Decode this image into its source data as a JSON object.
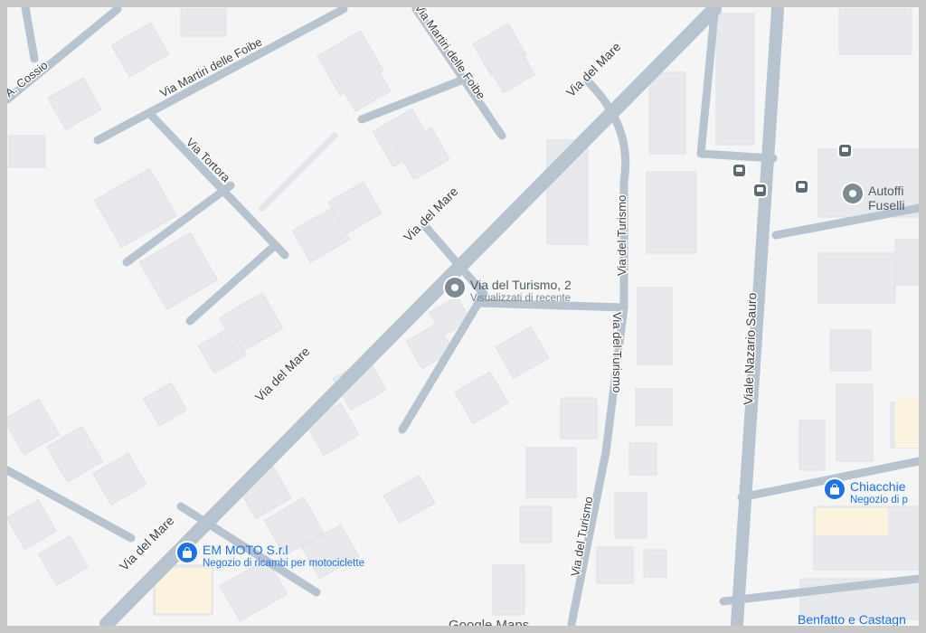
{
  "streets": {
    "cossio": "A. Cossio",
    "martiri_1": "Via Martiri delle Foibe",
    "martiri_2": "Via Martiri delle Foibe",
    "tortora": "Via Tortora",
    "mare_1": "Via del Mare",
    "mare_2": "Via del Mare",
    "mare_3": "Via del Mare",
    "mare_4": "Via del Mare",
    "turismo_1": "Via del Turismo",
    "turismo_2": "Via del Turismo",
    "turismo_3": "Via del Turismo",
    "sauro": "Viale Nazario Sauro"
  },
  "places": {
    "recent": {
      "title": "Via del Turismo, 2",
      "subtitle": "Visualizzati di recente"
    },
    "autofficina": {
      "line1": "Autoffi",
      "line2": "Fuselli"
    },
    "em_moto": {
      "title": "EM MOTO S.r.l",
      "subtitle": "Negozio di ricambi per motociclette"
    },
    "chiacchiere": {
      "title": "Chiacchie",
      "subtitle": "Negozio di p"
    },
    "benfatto": {
      "title": "Benfatto e Castagn"
    }
  },
  "watermark": "Google Maps",
  "icons": [
    "location-pin-icon",
    "shopping-bag-icon",
    "bus-stop-icon"
  ],
  "colors": {
    "background": "#f5f5f6",
    "road": "#b7c4cf",
    "building": "#e8e9ec",
    "accent": "#1a73e8",
    "pin": "#7f8b93"
  }
}
